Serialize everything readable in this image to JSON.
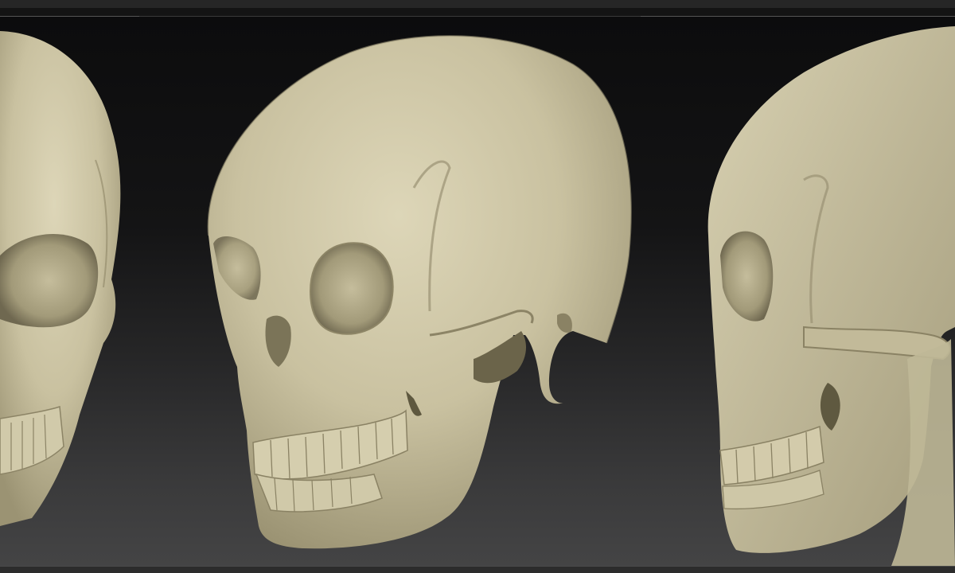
{
  "app": {
    "canvas": {
      "background_top": "#0c0c0d",
      "background_bottom": "#444445",
      "material_color": "#cfc8a8"
    },
    "renders": [
      {
        "name": "skull-front-three-quarter"
      },
      {
        "name": "skull-three-quarter"
      },
      {
        "name": "skull-side"
      }
    ]
  }
}
